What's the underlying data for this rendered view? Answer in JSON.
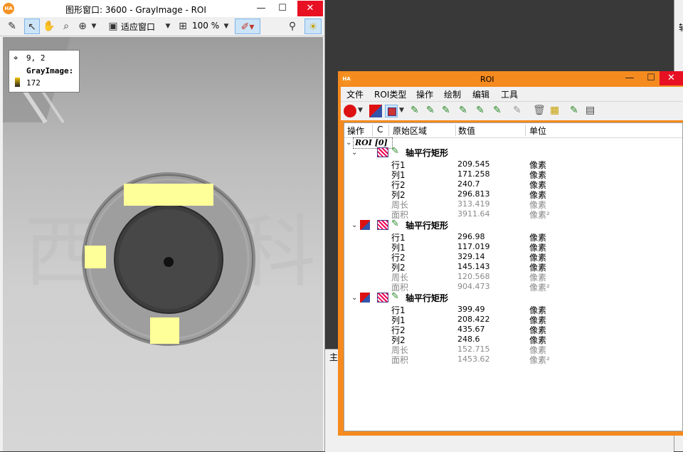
{
  "graphics_window": {
    "title": "图形窗口: 3600 - GrayImage - ROI",
    "fit_label": "适应窗口",
    "zoom_label": "100 %",
    "pixel_info": {
      "coords": "9, 2",
      "image_name": "GrayImage:",
      "value": "172"
    }
  },
  "roi_window": {
    "title": "ROI",
    "menu": [
      "文件",
      "ROI类型",
      "操作",
      "绘制",
      "编辑",
      "工具"
    ],
    "columns": [
      "操作",
      "C",
      "原始区域",
      "数值",
      "单位"
    ],
    "root_label": "ROI [0]",
    "groups": [
      {
        "title": "轴平行矩形",
        "rows": [
          {
            "label": "行1",
            "value": "209.545",
            "unit": "像素",
            "muted": false
          },
          {
            "label": "列1",
            "value": "171.258",
            "unit": "像素",
            "muted": false
          },
          {
            "label": "行2",
            "value": "240.7",
            "unit": "像素",
            "muted": false
          },
          {
            "label": "列2",
            "value": "296.813",
            "unit": "像素",
            "muted": false
          },
          {
            "label": "周长",
            "value": "313.419",
            "unit": "像素",
            "muted": true
          },
          {
            "label": "面积",
            "value": "3911.64",
            "unit": "像素²",
            "muted": true
          }
        ]
      },
      {
        "title": "轴平行矩形",
        "rows": [
          {
            "label": "行1",
            "value": "296.98",
            "unit": "像素",
            "muted": false
          },
          {
            "label": "列1",
            "value": "117.019",
            "unit": "像素",
            "muted": false
          },
          {
            "label": "行2",
            "value": "329.14",
            "unit": "像素",
            "muted": false
          },
          {
            "label": "列2",
            "value": "145.143",
            "unit": "像素",
            "muted": false
          },
          {
            "label": "周长",
            "value": "120.568",
            "unit": "像素",
            "muted": true
          },
          {
            "label": "面积",
            "value": "904.473",
            "unit": "像素²",
            "muted": true
          }
        ]
      },
      {
        "title": "轴平行矩形",
        "rows": [
          {
            "label": "行1",
            "value": "399.49",
            "unit": "像素",
            "muted": false
          },
          {
            "label": "列1",
            "value": "208.422",
            "unit": "像素",
            "muted": false
          },
          {
            "label": "行2",
            "value": "435.67",
            "unit": "像素",
            "muted": false
          },
          {
            "label": "列2",
            "value": "248.6",
            "unit": "像素",
            "muted": false
          },
          {
            "label": "周长",
            "value": "152.715",
            "unit": "像素",
            "muted": true
          },
          {
            "label": "面积",
            "value": "1453.62",
            "unit": "像素²",
            "muted": true
          }
        ]
      }
    ]
  },
  "background_labels": {
    "top_right": "轴",
    "mid_left": "主"
  },
  "colors": {
    "roi_frame": "#f58a1f",
    "roi_highlight": "#ffff99",
    "close_button": "#e81123",
    "logo": "#f39222"
  },
  "icons": [
    "halcon-logo-icon",
    "edit-icon",
    "pointer-icon",
    "hand-icon",
    "magnifier-icon",
    "zoom-icon",
    "fit-window-icon",
    "zoom-level-icon",
    "draw-roi-icon",
    "pixel-info-icon",
    "settings-lamp-icon"
  ]
}
